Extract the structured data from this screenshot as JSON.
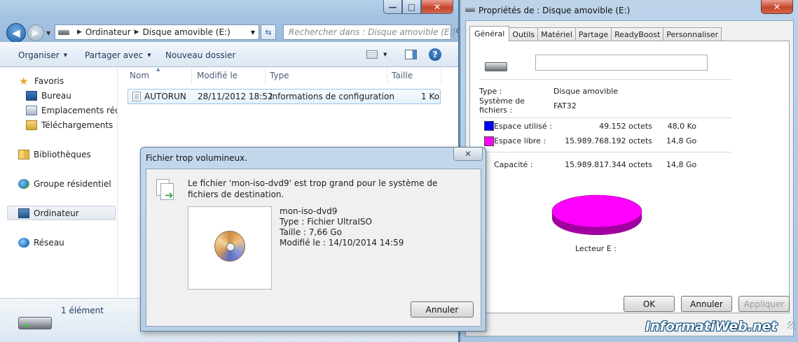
{
  "explorer": {
    "caption": {
      "minimize": "—",
      "maximize": "□",
      "close": "✕"
    },
    "address": {
      "crumb1": "Ordinateur",
      "crumb2": "Disque amovible (E:)"
    },
    "search": {
      "placeholder": "Rechercher dans : Disque amovible (E:)"
    },
    "toolbar": {
      "organize": "Organiser",
      "share": "Partager avec",
      "new_folder": "Nouveau dossier",
      "help": "?"
    },
    "nav": {
      "favorites": "Favoris",
      "desktop": "Bureau",
      "places": "Emplacements récents",
      "downloads": "Téléchargements",
      "libraries": "Bibliothèques",
      "homegroup": "Groupe résidentiel",
      "computer": "Ordinateur",
      "network": "Réseau"
    },
    "columns": {
      "name": "Nom",
      "modified": "Modifié le",
      "type": "Type",
      "size": "Taille"
    },
    "files": [
      {
        "name": "AUTORUN",
        "modified": "28/11/2012 18:52",
        "type": "Informations de configuration",
        "size": "1 Ko"
      }
    ],
    "status": "1 élément"
  },
  "dialog": {
    "title": "Fichier trop volumineux.",
    "close": "✕",
    "message": "Le fichier 'mon-iso-dvd9' est trop grand pour le système de fichiers de destination.",
    "file_name": "mon-iso-dvd9",
    "file_type": "Type : Fichier UltraISO",
    "file_size": "Taille : 7,66 Go",
    "file_modified": "Modifié le : 14/10/2014 14:59",
    "cancel": "Annuler"
  },
  "props": {
    "title": "Propriétés de : Disque amovible (E:)",
    "close": "✕",
    "tabs": [
      "Général",
      "Outils",
      "Matériel",
      "Partage",
      "ReadyBoost",
      "Personnaliser"
    ],
    "name_value": "",
    "type_label": "Type :",
    "type_value": "Disque amovible",
    "fs_label": "Système de fichiers :",
    "fs_value": "FAT32",
    "used_label": "Espace utilisé :",
    "used_bytes": "49.152 octets",
    "used_human": "48,0 Ko",
    "free_label": "Espace libre :",
    "free_bytes": "15.989.768.192 octets",
    "free_human": "14,8 Go",
    "capacity_label": "Capacité :",
    "capacity_bytes": "15.989.817.344 octets",
    "capacity_human": "14,8 Go",
    "drive_label": "Lecteur E :",
    "ok": "OK",
    "cancel": "Annuler",
    "apply": "Appliquer",
    "colors": {
      "used": "#0000ff",
      "free": "#ff00ff"
    }
  },
  "watermark": "InformatiWeb.net"
}
